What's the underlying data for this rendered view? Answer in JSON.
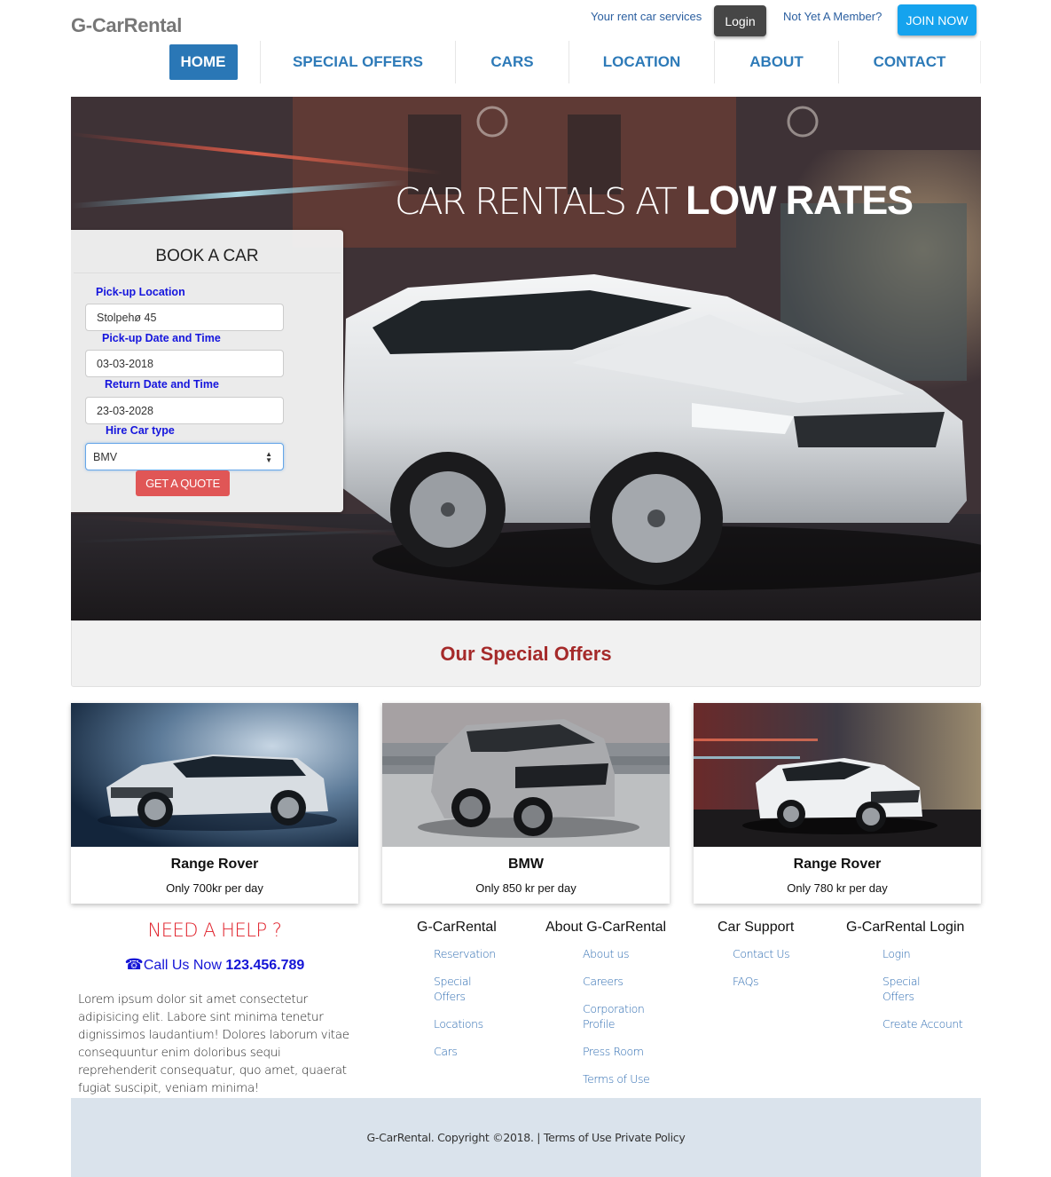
{
  "header": {
    "logo": "G-CarRental",
    "tagline": "Your rent car services",
    "login_label": "Login",
    "member_text": "Not Yet A Member?",
    "join_label": "JOIN NOW"
  },
  "nav": {
    "items": [
      {
        "label": "HOME",
        "active": true
      },
      {
        "label": "SPECIAL OFFERS"
      },
      {
        "label": "CARS"
      },
      {
        "label": "LOCATION"
      },
      {
        "label": "ABOUT"
      },
      {
        "label": "CONTACT"
      }
    ]
  },
  "hero": {
    "headline_thin": "CAR RENTALS AT ",
    "headline_bold": "LOW RATES"
  },
  "booking": {
    "title": "BOOK A CAR",
    "pickup_location_label": "Pick-up Location",
    "pickup_location_value": "Stolpehø 45",
    "pickup_date_label": "Pick-up Date and Time",
    "pickup_date_value": "03-03-2018",
    "return_date_label": "Return Date and Time",
    "return_date_value": "23-03-2028",
    "car_type_label": "Hire Car type",
    "car_type_value": "BMV",
    "quote_label": "GET A QUOTE"
  },
  "offers": {
    "title": "Our Special Offers",
    "cards": [
      {
        "name": "Range Rover",
        "price": "Only 700kr per day"
      },
      {
        "name": "BMW",
        "price": "Only 850 kr per day"
      },
      {
        "name": "Range Rover",
        "price": "Only 780 kr per day"
      }
    ]
  },
  "help": {
    "title": "NEED A HELP ?",
    "call_prefix": "Call Us Now ",
    "phone": "123.456.789",
    "body": "Lorem ipsum dolor sit amet consectetur adipisicing elit. Labore sint minima tenetur dignissimos laudantium! Dolores laborum vitae consequuntur enim doloribus sequi reprehenderit consequatur, quo amet, quaerat fugiat suscipit, veniam minima!"
  },
  "footer": {
    "columns": [
      {
        "title": "G-CarRental",
        "links": [
          "Reservation",
          "Special Offers",
          "Locations",
          "Cars"
        ]
      },
      {
        "title": "About G-CarRental",
        "links": [
          "About us",
          "Careers",
          "Corporation Profile",
          "Press Room",
          "Terms of Use"
        ]
      },
      {
        "title": "Car Support",
        "links": [
          "Contact Us",
          "FAQs"
        ]
      },
      {
        "title": "G-CarRental Login",
        "links": [
          "Login",
          "Special Offers",
          "Create Account"
        ]
      }
    ],
    "copyright": "G-CarRental. Copyright ©2018. | ",
    "terms_label": "Terms of Use",
    "privacy_label": " Private Policy"
  },
  "colors": {
    "nav_text": "#2d7ab8",
    "nav_active_bg": "#2a77b6",
    "join_bg": "#15a3ee",
    "login_bg": "#464646",
    "quote_bg": "#e05656",
    "offers_title": "#a52a2a",
    "help_title": "#e0202a",
    "form_label": "#1515dd",
    "footer_bg": "#dae3ec"
  },
  "icons": {
    "phone": "phone-icon",
    "select_arrows": "select-arrows-icon"
  }
}
